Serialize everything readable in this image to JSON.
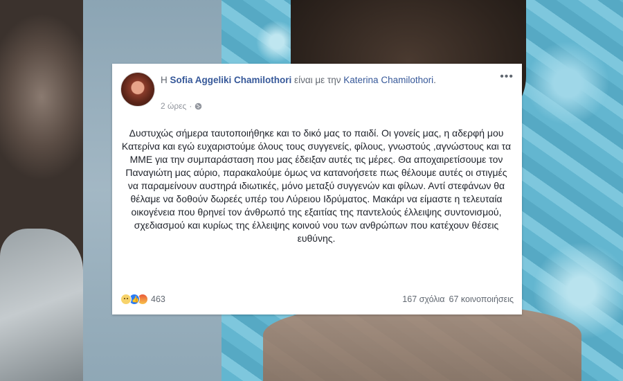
{
  "post": {
    "header": {
      "prefix": "Η",
      "author": "Sofia Aggeliki Chamilothori",
      "with_text": "είναι με την",
      "tagged": "Katerina Chamilothori",
      "suffix": ".",
      "time": "2 ώρες",
      "separator": "·",
      "privacy_icon": "globe-icon",
      "more_icon": "more-options-icon"
    },
    "body": "Δυστυχώς σήμερα ταυτοποιήθηκε και το δικό μας το παιδί. Οι γονείς μας, η αδερφή μου Κατερίνα και εγώ ευχαριστούμε όλους τους συγγενείς, φίλους, γνωστούς ,αγνώστους και τα ΜΜΕ για την συμπαράσταση που μας έδειξαν αυτές τις μέρες. Θα αποχαιρετίσουμε τον Παναγιώτη μας αύριο, παρακαλούμε όμως να κατανοήσετε πως θέλουμε αυτές οι στιγμές να παραμείνουν αυστηρά ιδιωτικές, μόνο μεταξύ συγγενών και φίλων. Αντί στεφάνων θα θέλαμε να δοθούν δωρεές υπέρ του Λύρειου Ιδρύματος. Μακάρι να είμαστε η τελευταία οικογένεια που θρηνεί τον άνθρωπό της εξαιτίας της παντελούς έλλειψης συντονισμού, σχεδιασμού και κυρίως της έλλειψης κοινού νου των ανθρώπων που κατέχουν θέσεις ευθύνης.",
    "footer": {
      "reaction_icons": [
        "sad-reaction-icon",
        "like-reaction-icon",
        "angry-reaction-icon"
      ],
      "reaction_count": "463",
      "comments": "167 σχόλια",
      "shares": "67 κοινοποιήσεις"
    },
    "colors": {
      "link": "#365899",
      "text": "#1d2129",
      "meta": "#90949c"
    }
  }
}
